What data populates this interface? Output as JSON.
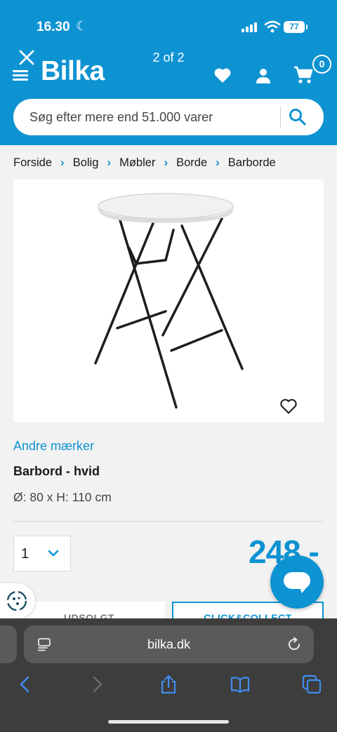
{
  "status_bar": {
    "time": "16.30",
    "battery": "77"
  },
  "header": {
    "logo": "Bilka",
    "page_count": "2 of 2",
    "cart_count": "0",
    "search_placeholder": "Søg efter mere end 51.000 varer"
  },
  "breadcrumb": [
    "Forside",
    "Bolig",
    "Møbler",
    "Borde",
    "Barborde"
  ],
  "product": {
    "brand": "Andre mærker",
    "title": "Barbord - hvid",
    "dimensions": "Ø: 80 x H: 110 cm",
    "quantity": "1",
    "price": "248,-",
    "button_soldout": "UDSOLGT",
    "button_collect": "CLICK&COLLECT"
  },
  "browser": {
    "url": "bilka.dk"
  },
  "colors": {
    "brand_blue": "#0e93d2",
    "text_dark": "#1a1a1a",
    "browser_bar": "#3d3d3d"
  },
  "icons": [
    "close-icon",
    "menu-icon",
    "heart-icon",
    "user-icon",
    "cart-icon",
    "search-icon",
    "chevron-right-icon",
    "chevron-down-icon",
    "chat-icon",
    "cookie-icon",
    "reader-icon",
    "reload-icon",
    "back-icon",
    "forward-icon",
    "share-icon",
    "bookmarks-icon",
    "tabs-icon"
  ]
}
